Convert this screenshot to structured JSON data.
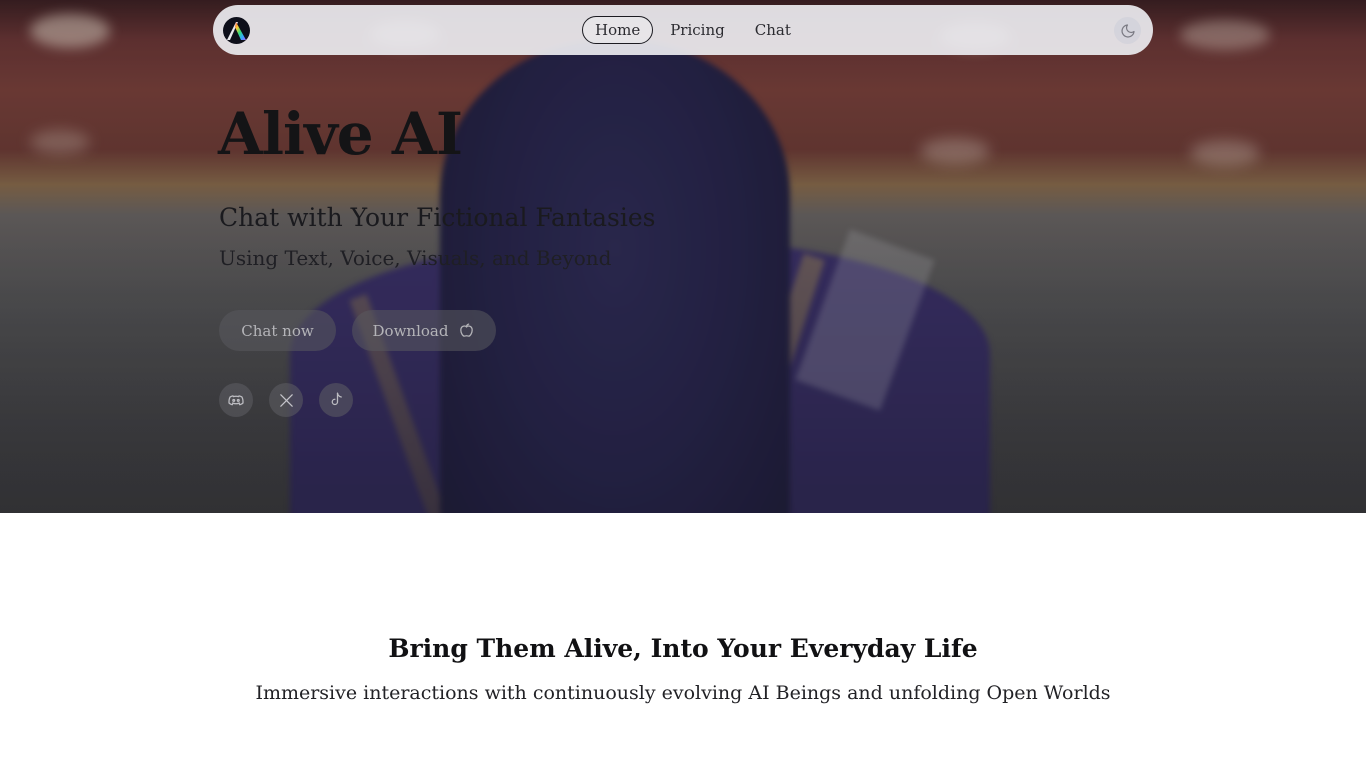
{
  "nav": {
    "logo_icon": "rainbow-slash-logo",
    "links": [
      {
        "label": "Home",
        "active": true
      },
      {
        "label": "Pricing",
        "active": false
      },
      {
        "label": "Chat",
        "active": false
      }
    ],
    "theme_toggle_icon": "moon-icon"
  },
  "hero": {
    "title": "Alive AI",
    "subtitle": "Chat with Your Fictional Fantasies",
    "tagline": "Using Text, Voice, Visuals, and Beyond",
    "chat_button": "Chat now",
    "download_button": "Download",
    "download_icon": "apple-icon",
    "socials": [
      "discord-icon",
      "x-icon",
      "tiktok-icon"
    ]
  },
  "section": {
    "title": "Bring Them Alive, Into Your Everyday Life",
    "subtitle": "Immersive interactions with continuously evolving AI Beings and unfolding Open Worlds"
  },
  "colors": {
    "nav_bg": "#ecebf0",
    "title_text": "#141416",
    "button_bg": "#5a5a5e",
    "button_text": "#b4b4b8"
  }
}
